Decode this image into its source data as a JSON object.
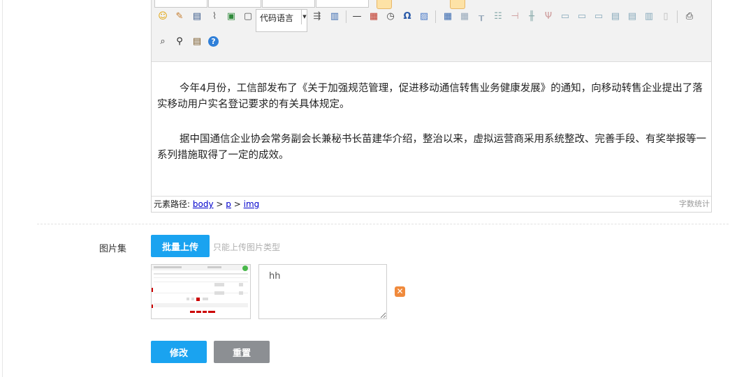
{
  "editor": {
    "language_select": "代码语言",
    "paragraphs": [
      "今年4月份，工信部发布了《关于加强规范管理，促进移动通信转售业务健康发展》的通知，向移动转售企业提出了落实移动用户实名登记要求的有关具体规定。",
      "据中国通信企业协会常务副会长兼秘书长苗建华介绍，整治以来，虚拟运营商采用系统整改、完善手段、有奖举报等一系列措施取得了一定的成效。"
    ],
    "status": {
      "path_label": "元素路径:",
      "path": [
        "body",
        "p",
        "img"
      ],
      "path_sep": ">",
      "word_count": "字数统计"
    },
    "toolbar_icons": [
      "emoticon-icon",
      "scrawl-icon",
      "video-icon",
      "attachment-icon",
      "image-icon",
      "insert-frame-icon",
      "pagebreak-icon",
      "template-icon",
      "horizontal-rule-icon",
      "date-icon",
      "time-icon",
      "special-char-icon",
      "word-image-icon",
      "insert-table-icon",
      "delete-table-icon",
      "insert-paragraph-before-table-icon",
      "insert-row-icon",
      "delete-row-icon",
      "insert-col-icon",
      "delete-col-icon",
      "merge-cells-icon",
      "merge-right-icon",
      "merge-down-icon",
      "split-cells-icon",
      "split-rows-icon",
      "split-cols-icon",
      "chart-icon",
      "print-icon",
      "preview-icon",
      "search-replace-icon",
      "drafts-icon",
      "help-icon"
    ]
  },
  "gallery": {
    "label": "图片集",
    "upload_button": "批量上传",
    "hint": "只能上传图片类型",
    "items": [
      {
        "caption": "hh"
      }
    ]
  },
  "actions": {
    "modify": "修改",
    "reset": "重置"
  },
  "colors": {
    "primary": "#1aa3f0",
    "secondary": "#8c8f93",
    "delete": "#f08a3c"
  }
}
